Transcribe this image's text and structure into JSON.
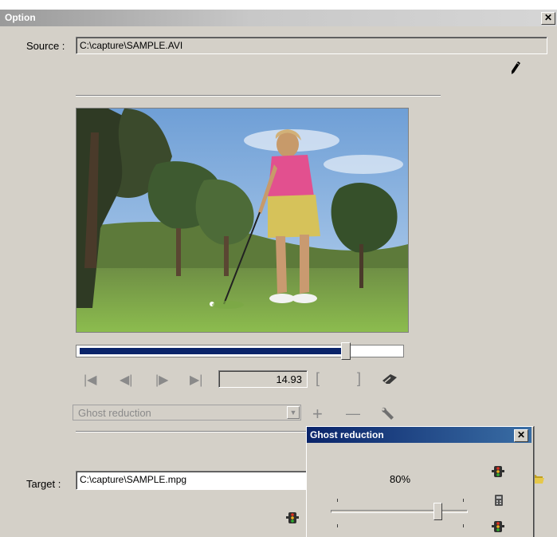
{
  "window": {
    "title": "Option",
    "close_label": "✕"
  },
  "source": {
    "label": "Source :",
    "value": "C:\\capture\\SAMPLE.AVI"
  },
  "target": {
    "label": "Target :",
    "value": "C:\\capture\\SAMPLE.mpg"
  },
  "seek": {
    "position": 0.83
  },
  "transport": {
    "time": "14.93",
    "first_glyph": "|◀",
    "prev_glyph": "◀|",
    "next_glyph": "|▶",
    "last_glyph": "▶|",
    "mark_in_glyph": "[",
    "mark_out_glyph": "]"
  },
  "filter": {
    "selected": "Ghost reduction",
    "dropdown_arrow": "▼",
    "add_glyph": "+",
    "remove_glyph": "—"
  },
  "popup": {
    "title": "Ghost reduction",
    "close_label": "✕",
    "value_label": "80%",
    "value": 0.8
  },
  "icons": {
    "edit": "pencil-icon",
    "eraser": "eraser-icon",
    "settings": "wrench-icon",
    "status": "traffic-light-icon",
    "calculator": "calculator-icon",
    "folder": "folder-icon"
  },
  "colors": {
    "dialog_bg": "#d4d0c8",
    "popup_title": "#0a246a",
    "seek_fill": "#0a246a"
  }
}
